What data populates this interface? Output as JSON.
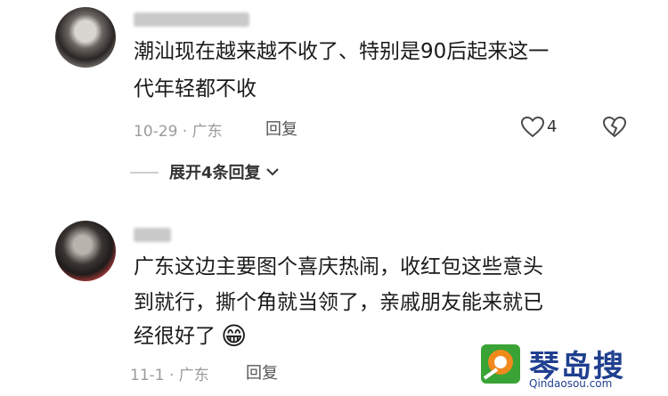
{
  "comments": [
    {
      "username": "",
      "text_line1": "潮汕现在越来越不收了、特别是90后起来这一",
      "text_line2": "代年轻都不收",
      "date_location": "10-29 · 广东",
      "reply_label": "回复",
      "like_count": "4"
    },
    {
      "username": "",
      "text_line1": "广东这边主要图个喜庆热闹，收红包这些意头",
      "text_line2": "到就行，撕个角就当领了，亲戚朋友能来就已",
      "text_line3": "经很好了",
      "emoji": "😁",
      "date_location": "11-1 · 广东",
      "reply_label": "回复"
    }
  ],
  "expand_replies": "展开4条回复",
  "watermark": {
    "brand": "琴岛搜",
    "url": "Qindaosou.com"
  },
  "colors": {
    "watermark_blue": "#1f3f8f",
    "watermark_orange": "#f08a1c",
    "watermark_green": "#3aa335"
  }
}
